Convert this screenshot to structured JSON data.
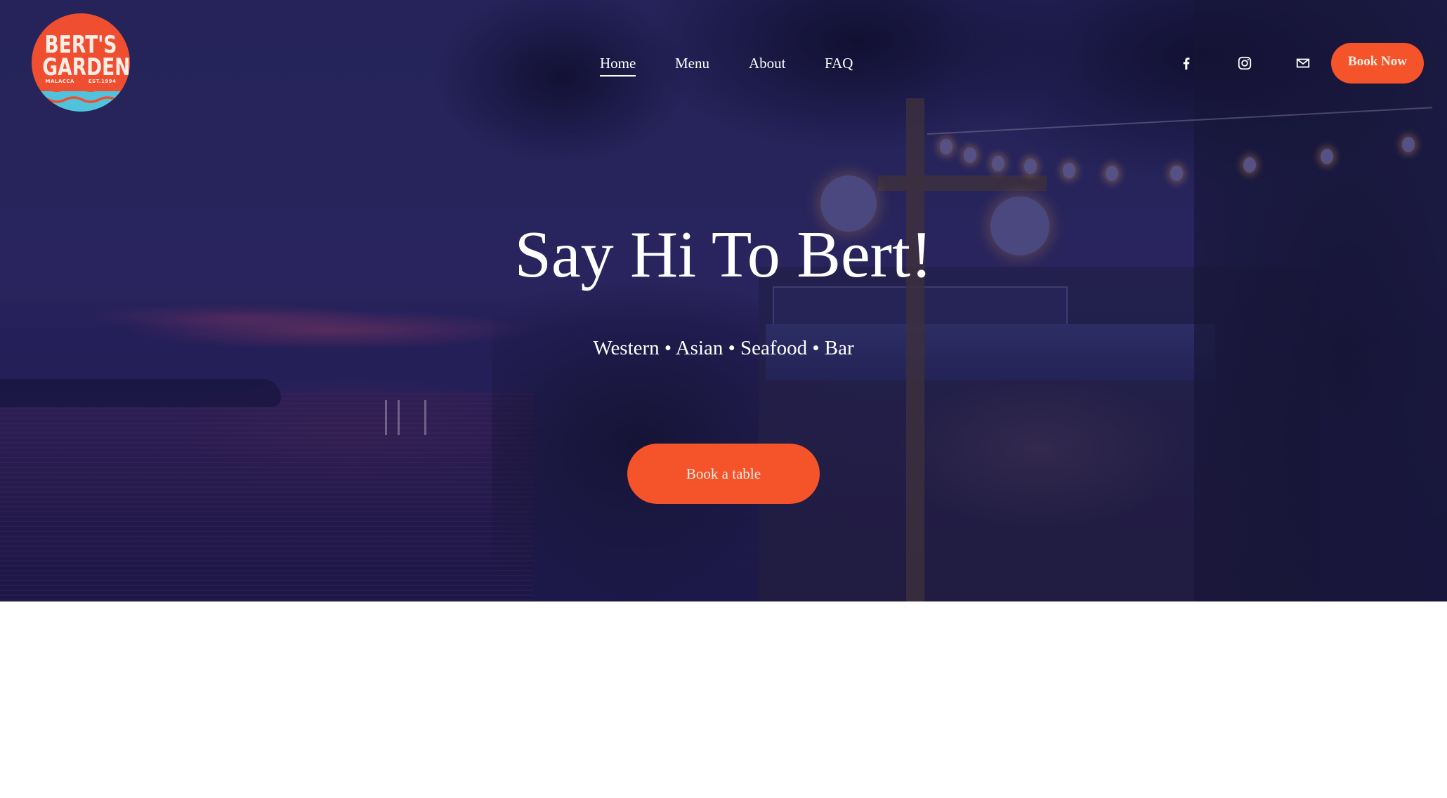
{
  "brand": {
    "logo_line1": "BERT'S",
    "logo_line2": "GARDEN",
    "logo_location": "MALACCA",
    "logo_est": "EST.1994",
    "logo_color": "#ef4e31",
    "logo_wave_color": "#4fc3dc"
  },
  "nav": {
    "items": [
      {
        "label": "Home",
        "active": true
      },
      {
        "label": "Menu",
        "active": false
      },
      {
        "label": "About",
        "active": false
      },
      {
        "label": "FAQ",
        "active": false
      }
    ]
  },
  "social": [
    {
      "icon": "facebook-icon"
    },
    {
      "icon": "instagram-icon"
    },
    {
      "icon": "mail-icon"
    }
  ],
  "header": {
    "book_now_label": "Book Now"
  },
  "hero": {
    "headline": "Say Hi To Bert!",
    "subtitle": "Western • Asian • Seafood • Bar",
    "cta_label": "Book a table",
    "accent_color": "#f5532a",
    "overlay_color": "#1c1a4a"
  }
}
